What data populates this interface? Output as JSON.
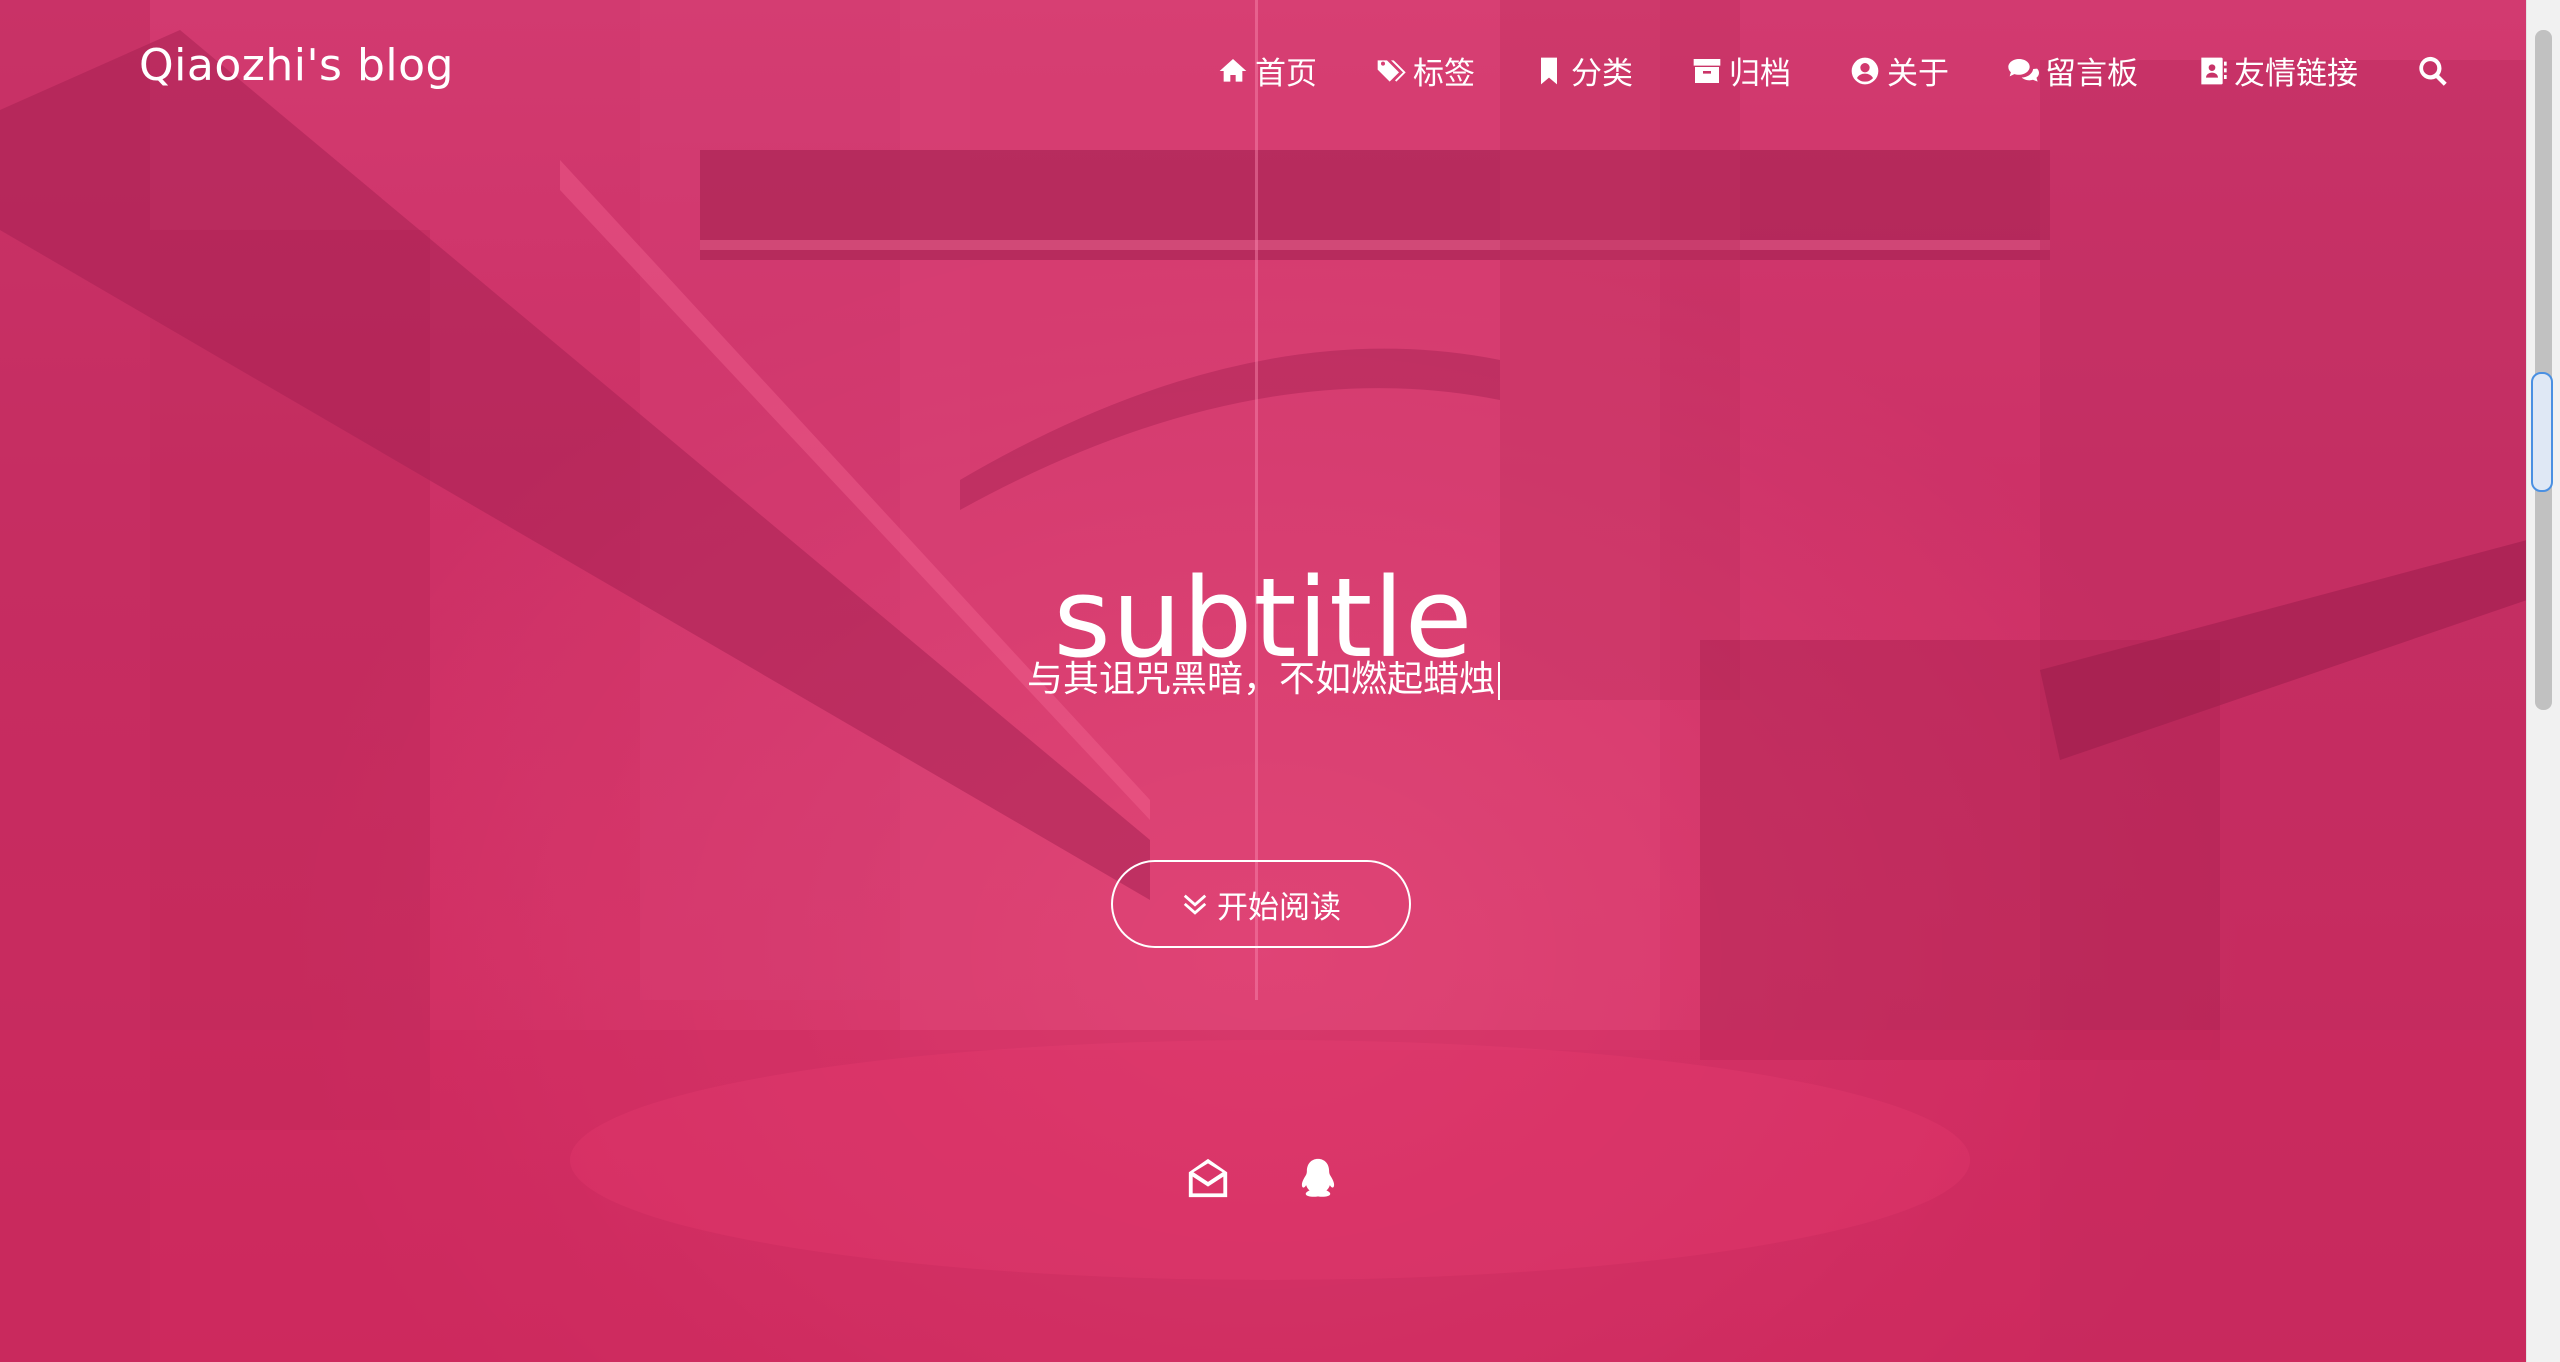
{
  "site": {
    "brand": "Qiaozhi's blog"
  },
  "nav": {
    "items": [
      {
        "label": "首页",
        "icon": "home-icon"
      },
      {
        "label": "标签",
        "icon": "tags-icon"
      },
      {
        "label": "分类",
        "icon": "bookmark-icon"
      },
      {
        "label": "归档",
        "icon": "archive-icon"
      },
      {
        "label": "关于",
        "icon": "user-circle-icon"
      },
      {
        "label": "留言板",
        "icon": "comments-icon"
      },
      {
        "label": "友情链接",
        "icon": "address-book-icon"
      }
    ],
    "search_icon": "search-icon"
  },
  "hero": {
    "title": "subtitle",
    "subtitle": "与其诅咒黑暗，不如燃起蜡烛",
    "button_label": "开始阅读",
    "button_icon": "double-chevron-down-icon"
  },
  "social": {
    "icons": [
      "envelope-open-icon",
      "qq-icon"
    ]
  },
  "colors": {
    "overlay_pink": "#c8336a",
    "text": "#ffffff"
  }
}
